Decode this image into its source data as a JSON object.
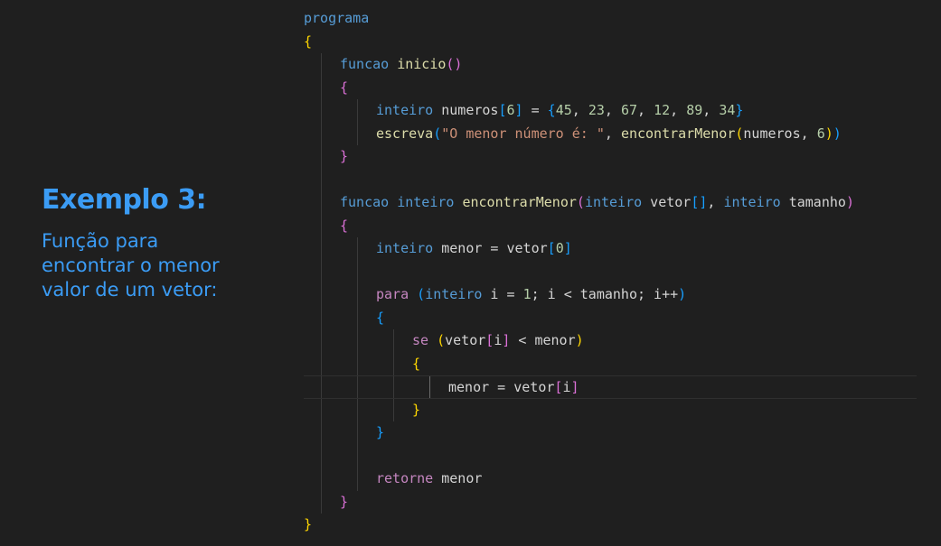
{
  "slide": {
    "title": "Exemplo 3:",
    "description": "Função para encontrar o menor valor de um vetor:"
  },
  "editor": {
    "theme": {
      "background": "#1f1f1f",
      "keyword": "#569cd6",
      "control": "#c586c0",
      "function": "#dcdcaa",
      "variable": "#d4d4d4",
      "number": "#b5cea8",
      "string": "#ce9178",
      "bracket_level_1": "#ffd700",
      "bracket_level_2": "#da70d6",
      "bracket_level_3": "#179fff"
    },
    "current_line": 17,
    "lines": [
      {
        "indent": 0,
        "tokens": [
          [
            "programa",
            "kw"
          ]
        ]
      },
      {
        "indent": 0,
        "tokens": [
          [
            "{",
            "b1"
          ]
        ]
      },
      {
        "indent": 1,
        "tokens": [
          [
            "funcao",
            "kw"
          ],
          [
            " ",
            "var"
          ],
          [
            "inicio",
            "fn"
          ],
          [
            "()",
            "b2"
          ]
        ]
      },
      {
        "indent": 1,
        "tokens": [
          [
            "{",
            "b2"
          ]
        ]
      },
      {
        "indent": 2,
        "tokens": [
          [
            "inteiro",
            "kw"
          ],
          [
            " numeros",
            "var"
          ],
          [
            "[",
            "b3"
          ],
          [
            "6",
            "num"
          ],
          [
            "]",
            "b3"
          ],
          [
            " = ",
            "var"
          ],
          [
            "{",
            "b3"
          ],
          [
            "45",
            "num"
          ],
          [
            ", ",
            "var"
          ],
          [
            "23",
            "num"
          ],
          [
            ", ",
            "var"
          ],
          [
            "67",
            "num"
          ],
          [
            ", ",
            "var"
          ],
          [
            "12",
            "num"
          ],
          [
            ", ",
            "var"
          ],
          [
            "89",
            "num"
          ],
          [
            ", ",
            "var"
          ],
          [
            "34",
            "num"
          ],
          [
            "}",
            "b3"
          ]
        ]
      },
      {
        "indent": 2,
        "tokens": [
          [
            "escreva",
            "fn"
          ],
          [
            "(",
            "b3"
          ],
          [
            "\"O menor número é: \"",
            "str"
          ],
          [
            ", ",
            "var"
          ],
          [
            "encontrarMenor",
            "fn"
          ],
          [
            "(",
            "b1"
          ],
          [
            "numeros",
            "var"
          ],
          [
            ", ",
            "var"
          ],
          [
            "6",
            "num"
          ],
          [
            ")",
            "b1"
          ],
          [
            ")",
            "b3"
          ]
        ]
      },
      {
        "indent": 1,
        "tokens": [
          [
            "}",
            "b2"
          ]
        ]
      },
      {
        "indent": 1,
        "tokens": []
      },
      {
        "indent": 1,
        "tokens": [
          [
            "funcao",
            "kw"
          ],
          [
            " ",
            "var"
          ],
          [
            "inteiro",
            "kw"
          ],
          [
            " ",
            "var"
          ],
          [
            "encontrarMenor",
            "fn"
          ],
          [
            "(",
            "b2"
          ],
          [
            "inteiro",
            "kw"
          ],
          [
            " vetor",
            "var"
          ],
          [
            "[]",
            "b3"
          ],
          [
            ", ",
            "var"
          ],
          [
            "inteiro",
            "kw"
          ],
          [
            " tamanho",
            "var"
          ],
          [
            ")",
            "b2"
          ]
        ]
      },
      {
        "indent": 1,
        "tokens": [
          [
            "{",
            "b2"
          ]
        ]
      },
      {
        "indent": 2,
        "tokens": [
          [
            "inteiro",
            "kw"
          ],
          [
            " menor = vetor",
            "var"
          ],
          [
            "[",
            "b3"
          ],
          [
            "0",
            "num"
          ],
          [
            "]",
            "b3"
          ]
        ]
      },
      {
        "indent": 2,
        "tokens": []
      },
      {
        "indent": 2,
        "tokens": [
          [
            "para",
            "ctl"
          ],
          [
            " ",
            "var"
          ],
          [
            "(",
            "b3"
          ],
          [
            "inteiro",
            "kw"
          ],
          [
            " i = ",
            "var"
          ],
          [
            "1",
            "num"
          ],
          [
            "; i < tamanho; i++",
            "var"
          ],
          [
            ")",
            "b3"
          ]
        ]
      },
      {
        "indent": 2,
        "tokens": [
          [
            "{",
            "b3"
          ]
        ]
      },
      {
        "indent": 3,
        "tokens": [
          [
            "se",
            "ctl"
          ],
          [
            " ",
            "var"
          ],
          [
            "(",
            "b1"
          ],
          [
            "vetor",
            "var"
          ],
          [
            "[",
            "b2"
          ],
          [
            "i",
            "var"
          ],
          [
            "]",
            "b2"
          ],
          [
            " < menor",
            "var"
          ],
          [
            ")",
            "b1"
          ]
        ]
      },
      {
        "indent": 3,
        "tokens": [
          [
            "{",
            "b1"
          ]
        ]
      },
      {
        "indent": 4,
        "tokens": [
          [
            "menor = vetor",
            "var"
          ],
          [
            "[",
            "b2"
          ],
          [
            "i",
            "var"
          ],
          [
            "]",
            "b2"
          ]
        ]
      },
      {
        "indent": 3,
        "tokens": [
          [
            "}",
            "b1"
          ]
        ]
      },
      {
        "indent": 2,
        "tokens": [
          [
            "}",
            "b3"
          ]
        ]
      },
      {
        "indent": 2,
        "tokens": []
      },
      {
        "indent": 2,
        "tokens": [
          [
            "retorne",
            "ctl"
          ],
          [
            " menor",
            "var"
          ]
        ]
      },
      {
        "indent": 1,
        "tokens": [
          [
            "}",
            "b2"
          ]
        ]
      },
      {
        "indent": 0,
        "tokens": [
          [
            "}",
            "b1"
          ]
        ]
      }
    ]
  }
}
